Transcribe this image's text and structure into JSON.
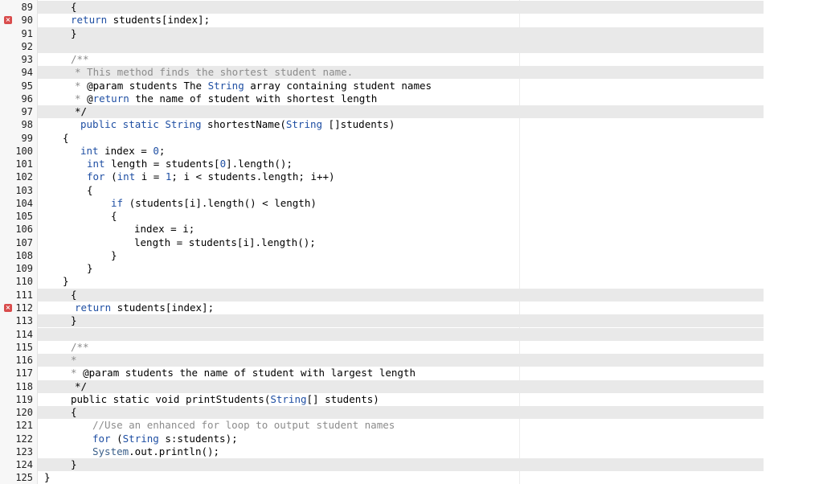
{
  "editor": {
    "error_marker_glyph": "×",
    "colors": {
      "highlight_band": "#e9e9e9",
      "keyword": "#1f4fa3",
      "comment": "#8c8c8c",
      "error_marker": "#d94c4c",
      "gutter": "#f7f7f7"
    },
    "lines": [
      {
        "n": "89",
        "hl": true,
        "err": false,
        "indent": 88,
        "segs": [
          {
            "t": "{"
          }
        ]
      },
      {
        "n": "90",
        "hl": false,
        "err": true,
        "indent": 88,
        "segs": [
          {
            "t": "return",
            "c": "kw"
          },
          {
            "t": " students[index];"
          }
        ]
      },
      {
        "n": "91",
        "hl": true,
        "err": false,
        "indent": 88,
        "segs": [
          {
            "t": "}"
          }
        ]
      },
      {
        "n": "92",
        "hl": true,
        "err": false,
        "indent": 88,
        "segs": []
      },
      {
        "n": "93",
        "hl": false,
        "err": false,
        "indent": 88,
        "segs": [
          {
            "t": "/**",
            "c": "cm"
          }
        ]
      },
      {
        "n": "94",
        "hl": true,
        "err": false,
        "indent": 93,
        "segs": [
          {
            "t": "* This method finds the shortest student name.",
            "c": "cm"
          }
        ]
      },
      {
        "n": "95",
        "hl": false,
        "err": false,
        "indent": 93,
        "segs": [
          {
            "t": "* ",
            "c": "cm"
          },
          {
            "t": "@param students The "
          },
          {
            "t": "String",
            "c": "kw"
          },
          {
            "t": " array containing student names"
          }
        ]
      },
      {
        "n": "96",
        "hl": false,
        "err": false,
        "indent": 93,
        "segs": [
          {
            "t": "* ",
            "c": "cm"
          },
          {
            "t": "@"
          },
          {
            "t": "return",
            "c": "kw"
          },
          {
            "t": " the name of student with shortest length"
          }
        ]
      },
      {
        "n": "97",
        "hl": true,
        "err": false,
        "indent": 93,
        "segs": [
          {
            "t": "*/"
          }
        ]
      },
      {
        "n": "98",
        "hl": false,
        "err": false,
        "indent": 100,
        "segs": [
          {
            "t": "public static ",
            "c": "kw"
          },
          {
            "t": "String",
            "c": "kw"
          },
          {
            "t": " shortestName("
          },
          {
            "t": "String",
            "c": "kw"
          },
          {
            "t": " []students)"
          }
        ]
      },
      {
        "n": "99",
        "hl": false,
        "err": false,
        "indent": 78,
        "segs": [
          {
            "t": "{"
          }
        ]
      },
      {
        "n": "100",
        "hl": false,
        "err": false,
        "indent": 100,
        "segs": [
          {
            "t": "int",
            "c": "kw"
          },
          {
            "t": " index = "
          },
          {
            "t": "0",
            "c": "num"
          },
          {
            "t": ";"
          }
        ]
      },
      {
        "n": "101",
        "hl": false,
        "err": false,
        "indent": 108,
        "segs": [
          {
            "t": "int",
            "c": "kw"
          },
          {
            "t": " length = students["
          },
          {
            "t": "0",
            "c": "num"
          },
          {
            "t": "].length();"
          }
        ]
      },
      {
        "n": "102",
        "hl": false,
        "err": false,
        "indent": 108,
        "segs": [
          {
            "t": "for",
            "c": "kw"
          },
          {
            "t": " ("
          },
          {
            "t": "int",
            "c": "kw"
          },
          {
            "t": " i = "
          },
          {
            "t": "1",
            "c": "num"
          },
          {
            "t": "; i < students.length; i++)"
          }
        ]
      },
      {
        "n": "103",
        "hl": false,
        "err": false,
        "indent": 108,
        "segs": [
          {
            "t": "{"
          }
        ]
      },
      {
        "n": "104",
        "hl": false,
        "err": false,
        "indent": 138,
        "segs": [
          {
            "t": "if",
            "c": "kw"
          },
          {
            "t": " (students[i].length() < length)"
          }
        ]
      },
      {
        "n": "105",
        "hl": false,
        "err": false,
        "indent": 138,
        "segs": [
          {
            "t": "{"
          }
        ]
      },
      {
        "n": "106",
        "hl": false,
        "err": false,
        "indent": 167,
        "segs": [
          {
            "t": "index = i;"
          }
        ]
      },
      {
        "n": "107",
        "hl": false,
        "err": false,
        "indent": 167,
        "segs": [
          {
            "t": "length = students[i].length();"
          }
        ]
      },
      {
        "n": "108",
        "hl": false,
        "err": false,
        "indent": 138,
        "segs": [
          {
            "t": "}"
          }
        ]
      },
      {
        "n": "109",
        "hl": false,
        "err": false,
        "indent": 108,
        "segs": [
          {
            "t": "}"
          }
        ]
      },
      {
        "n": "110",
        "hl": false,
        "err": false,
        "indent": 78,
        "segs": [
          {
            "t": "}"
          }
        ]
      },
      {
        "n": "111",
        "hl": true,
        "err": false,
        "indent": 88,
        "segs": [
          {
            "t": "{"
          }
        ]
      },
      {
        "n": "112",
        "hl": false,
        "err": true,
        "indent": 93,
        "segs": [
          {
            "t": "return",
            "c": "kw"
          },
          {
            "t": " students[index];"
          }
        ]
      },
      {
        "n": "113",
        "hl": true,
        "err": false,
        "indent": 88,
        "segs": [
          {
            "t": "}"
          }
        ]
      },
      {
        "n": "114",
        "hl": true,
        "err": false,
        "indent": 88,
        "segs": []
      },
      {
        "n": "115",
        "hl": false,
        "err": false,
        "indent": 88,
        "segs": [
          {
            "t": "/**",
            "c": "cm"
          }
        ]
      },
      {
        "n": "116",
        "hl": true,
        "err": false,
        "indent": 88,
        "segs": [
          {
            "t": "*",
            "c": "cm"
          }
        ]
      },
      {
        "n": "117",
        "hl": false,
        "err": false,
        "indent": 88,
        "segs": [
          {
            "t": "* ",
            "c": "cm"
          },
          {
            "t": "@param students the name of student with largest length"
          }
        ]
      },
      {
        "n": "118",
        "hl": true,
        "err": false,
        "indent": 93,
        "segs": [
          {
            "t": "*/"
          }
        ]
      },
      {
        "n": "119",
        "hl": false,
        "err": false,
        "indent": 88,
        "segs": [
          {
            "t": "public static void printStudents("
          },
          {
            "t": "String",
            "c": "kw"
          },
          {
            "t": "[] students)"
          }
        ]
      },
      {
        "n": "120",
        "hl": true,
        "err": false,
        "indent": 88,
        "segs": [
          {
            "t": "{"
          }
        ]
      },
      {
        "n": "121",
        "hl": false,
        "err": false,
        "indent": 115,
        "segs": [
          {
            "t": "//Use an enhanced for loop to output student names",
            "c": "cm"
          }
        ]
      },
      {
        "n": "122",
        "hl": false,
        "err": false,
        "indent": 115,
        "segs": [
          {
            "t": "for",
            "c": "kw"
          },
          {
            "t": " ("
          },
          {
            "t": "String",
            "c": "kw"
          },
          {
            "t": " s:students);"
          }
        ]
      },
      {
        "n": "123",
        "hl": false,
        "err": false,
        "indent": 115,
        "segs": [
          {
            "t": "System",
            "c": "ty"
          },
          {
            "t": ".out.println();"
          }
        ]
      },
      {
        "n": "124",
        "hl": true,
        "err": false,
        "indent": 88,
        "segs": [
          {
            "t": "}"
          }
        ]
      },
      {
        "n": "125",
        "hl": false,
        "err": false,
        "indent": 55,
        "segs": [
          {
            "t": "}"
          }
        ]
      }
    ]
  }
}
